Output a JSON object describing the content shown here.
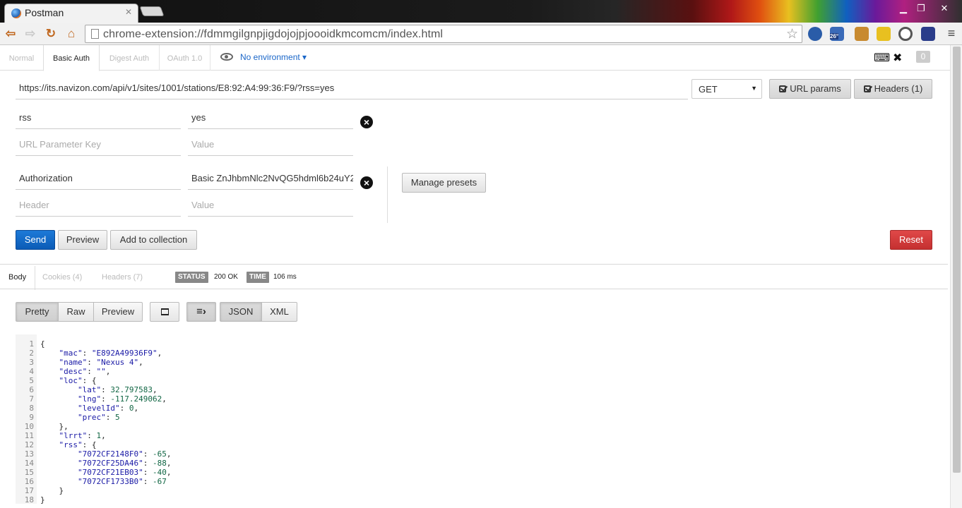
{
  "browser": {
    "tab_title": "Postman",
    "url": "chrome-extension://fdmmgilgnpjigdojojpjoooidkmcomcm/index.html",
    "extension_badge": "26°"
  },
  "auth_tabs": [
    "Normal",
    "Basic Auth",
    "Digest Auth",
    "OAuth 1.0"
  ],
  "environment": "No environment",
  "counter_badge": "0",
  "request": {
    "url": "https://its.navizon.com/api/v1/sites/1001/stations/E8:92:A4:99:36:F9/?rss=yes",
    "method": "GET",
    "url_params_button": "URL params",
    "headers_button": "Headers (1)",
    "params": [
      {
        "key": "rss",
        "value": "yes"
      }
    ],
    "param_key_placeholder": "URL Parameter Key",
    "param_value_placeholder": "Value",
    "headers": [
      {
        "key": "Authorization",
        "value": "Basic ZnJhbmNlc2NvQG5hdml6b24uY2"
      }
    ],
    "header_key_placeholder": "Header",
    "header_value_placeholder": "Value",
    "manage_presets": "Manage presets",
    "send": "Send",
    "preview": "Preview",
    "add_to_collection": "Add to collection",
    "reset": "Reset"
  },
  "response": {
    "tabs": [
      "Body",
      "Cookies (4)",
      "Headers (7)"
    ],
    "status_label": "STATUS",
    "status_value": "200 OK",
    "time_label": "TIME",
    "time_value": "106 ms",
    "view_modes": [
      "Pretty",
      "Raw",
      "Preview"
    ],
    "formats": [
      "JSON",
      "XML"
    ],
    "code_lines": [
      "{",
      "    \"mac\": \"E892A49936F9\",",
      "    \"name\": \"Nexus 4\",",
      "    \"desc\": \"\",",
      "    \"loc\": {",
      "        \"lat\": 32.797583,",
      "        \"lng\": -117.249062,",
      "        \"levelId\": 0,",
      "        \"prec\": 5",
      "    },",
      "    \"lrrt\": 1,",
      "    \"rss\": {",
      "        \"7072CF2148F0\": -65,",
      "        \"7072CF25DA46\": -88,",
      "        \"7072CF21EB03\": -40,",
      "        \"7072CF1733B0\": -67",
      "    }",
      "}"
    ]
  }
}
